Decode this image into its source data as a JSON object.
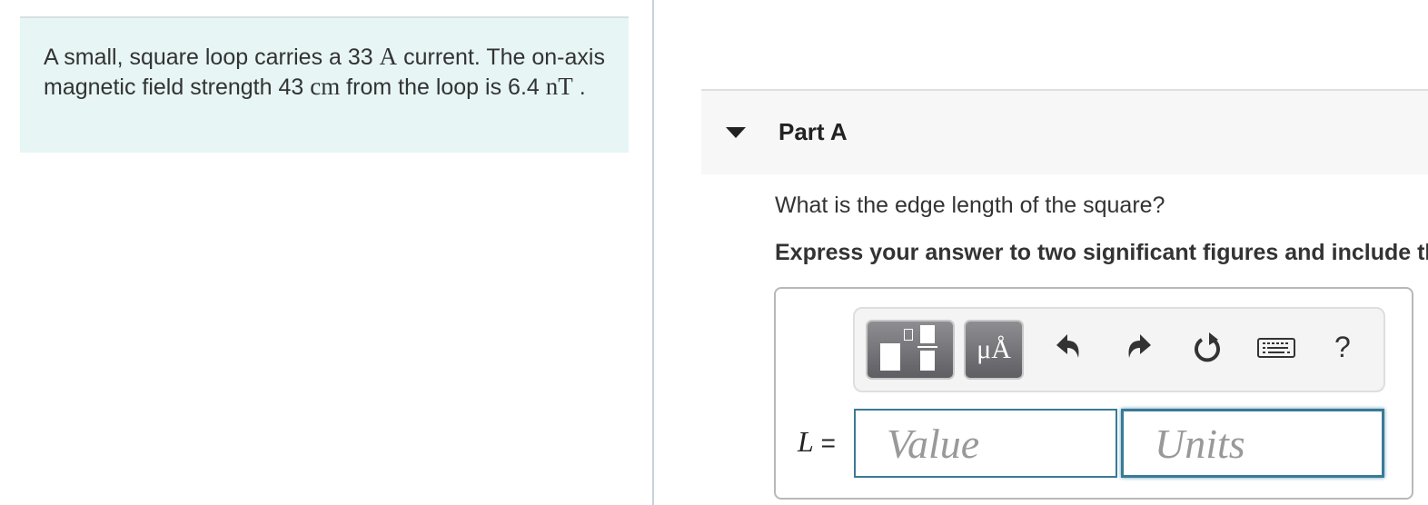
{
  "problem": {
    "segments": [
      {
        "text": "A small, square loop carries a 33 ",
        "math": false
      },
      {
        "text": "A",
        "math": true
      },
      {
        "text": " current. The on-axis magnetic field strength 43 ",
        "math": false
      },
      {
        "text": "cm",
        "math": true
      },
      {
        "text": " from the loop is 6.4 ",
        "math": false
      },
      {
        "text": "nT",
        "math": true
      },
      {
        "text": " .",
        "math": false
      }
    ]
  },
  "part": {
    "title": "Part A",
    "question": "What is the edge length of the square?",
    "instruction": "Express your answer to two significant figures and include the appropriate units."
  },
  "toolbar": {
    "symbols_label": "μÅ",
    "help_label": "?",
    "icons": [
      "templates-icon",
      "symbols-icon",
      "undo-icon",
      "redo-icon",
      "reset-icon",
      "keyboard-icon",
      "help-icon"
    ]
  },
  "answer": {
    "variable": "L",
    "equals": "=",
    "value_placeholder": "Value",
    "units_placeholder": "Units",
    "value": "",
    "units": ""
  }
}
